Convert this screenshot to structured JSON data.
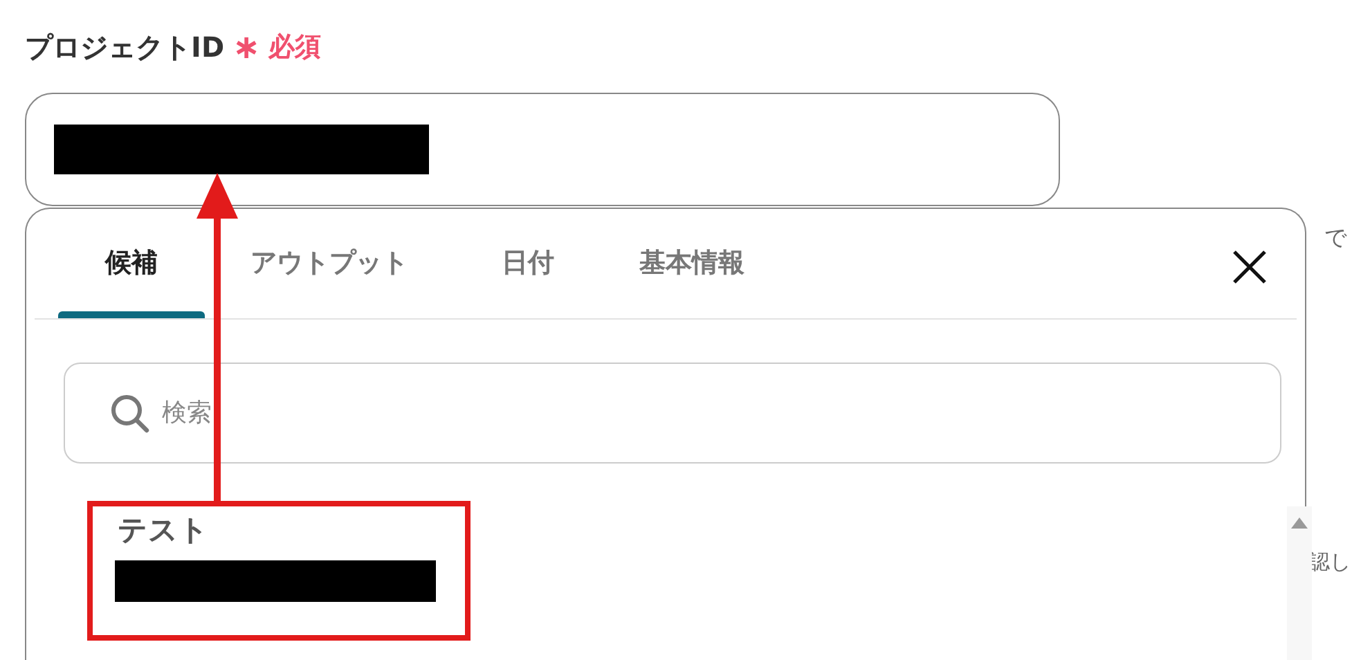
{
  "field": {
    "label": "プロジェクトID",
    "required_mark": "∗",
    "required_text": "必須"
  },
  "dropdown": {
    "tabs": [
      {
        "label": "候補",
        "selected": true
      },
      {
        "label": "アウトプット",
        "selected": false
      },
      {
        "label": "日付",
        "selected": false
      },
      {
        "label": "基本情報",
        "selected": false
      }
    ],
    "search": {
      "placeholder": "検索"
    },
    "items": [
      {
        "label": "テスト"
      }
    ]
  },
  "background_text": [
    "で",
    "認し"
  ]
}
